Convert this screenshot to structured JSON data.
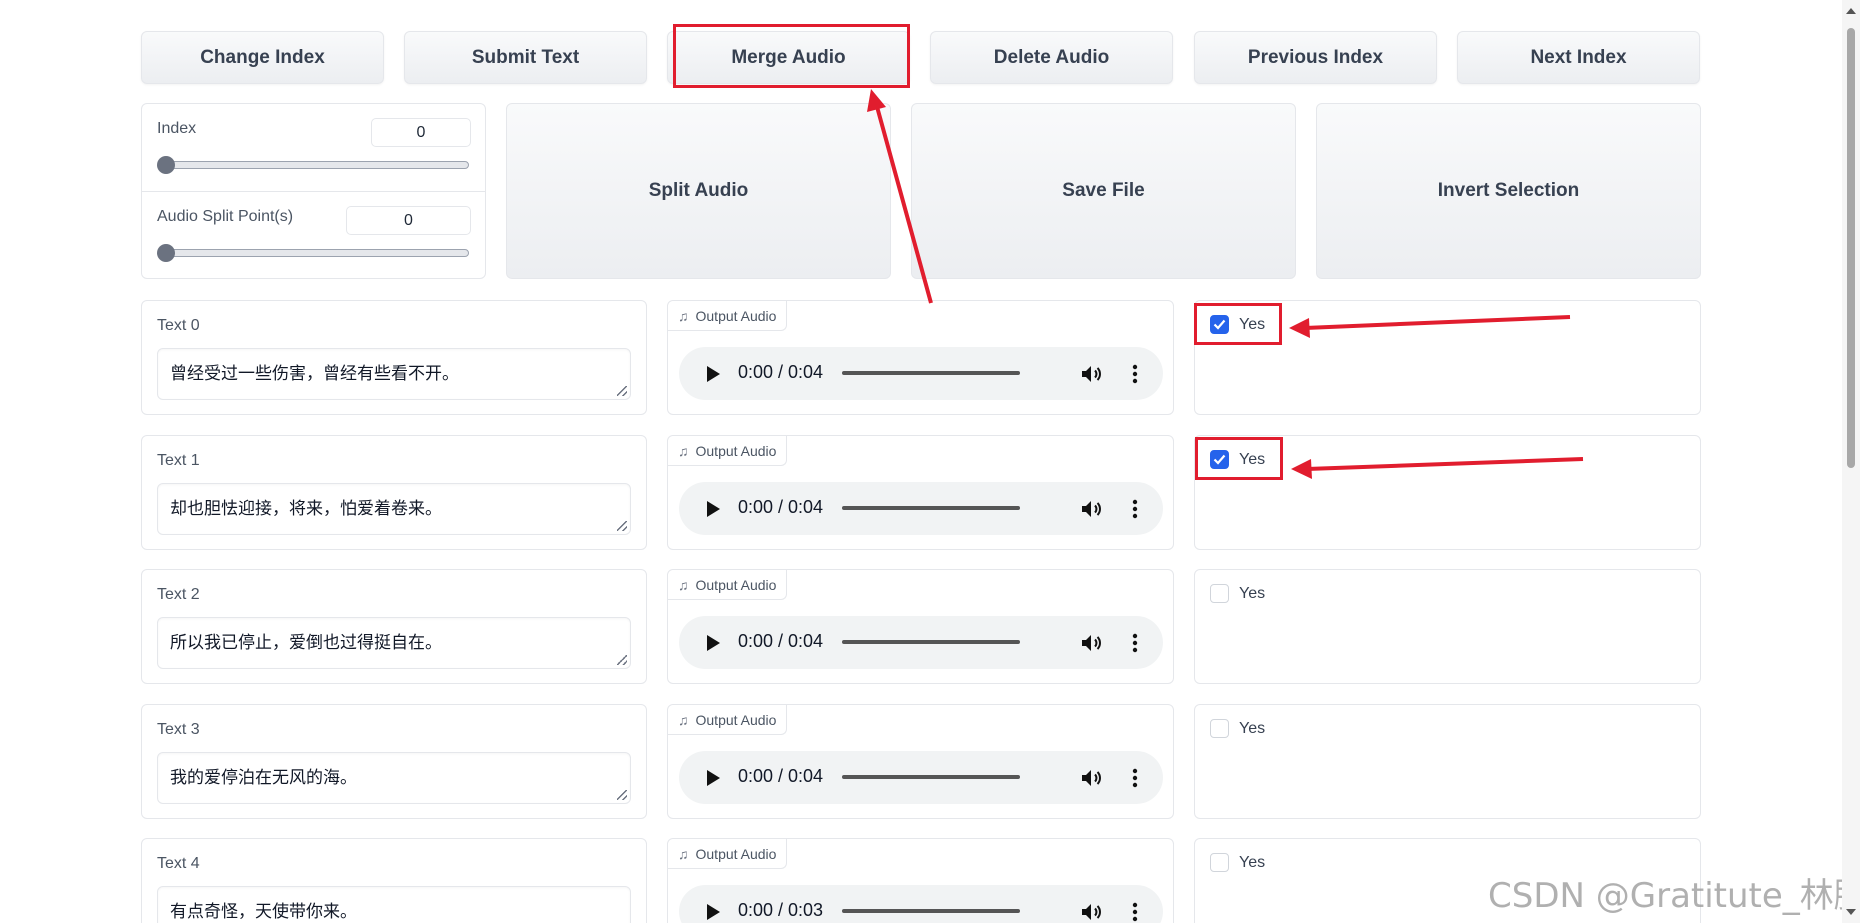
{
  "toolbar": {
    "change_index": "Change Index",
    "submit_text": "Submit Text",
    "merge_audio": "Merge Audio",
    "delete_audio": "Delete Audio",
    "previous_index": "Previous Index",
    "next_index": "Next Index"
  },
  "index_slider": {
    "label": "Index",
    "value": "0"
  },
  "split_slider": {
    "label": "Audio Split Point(s)",
    "value": "0"
  },
  "actions": {
    "split_audio": "Split Audio",
    "save_file": "Save File",
    "invert_selection": "Invert Selection"
  },
  "rows": [
    {
      "label": "Text 0",
      "text": "曾经受过一些伤害，曾经有些看不开。",
      "audio_label": "Output Audio",
      "time": "0:00 / 0:04",
      "checkbox_label": "Yes",
      "checked": true
    },
    {
      "label": "Text 1",
      "text": "却也胆怯迎接，将来，怕爱着卷来。",
      "audio_label": "Output Audio",
      "time": "0:00 / 0:04",
      "checkbox_label": "Yes",
      "checked": true
    },
    {
      "label": "Text 2",
      "text": "所以我已停止，爱倒也过得挺自在。",
      "audio_label": "Output Audio",
      "time": "0:00 / 0:04",
      "checkbox_label": "Yes",
      "checked": false
    },
    {
      "label": "Text 3",
      "text": "我的爱停泊在无风的海。",
      "audio_label": "Output Audio",
      "time": "0:00 / 0:04",
      "checkbox_label": "Yes",
      "checked": false
    },
    {
      "label": "Text 4",
      "text": "有点奇怪，天使带你来。",
      "audio_label": "Output Audio",
      "time": "0:00 / 0:03",
      "checkbox_label": "Yes",
      "checked": false
    }
  ],
  "watermark": "CSDN @Gratitute_林腾",
  "colors": {
    "annotation": "#e11d2e",
    "checkbox_checked": "#2563eb"
  }
}
